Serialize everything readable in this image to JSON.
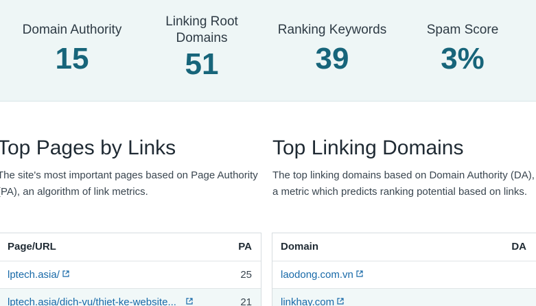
{
  "metrics": [
    {
      "label": "Domain Authority",
      "value": "15"
    },
    {
      "label_line1": "Linking Root",
      "label_line2": "Domains",
      "value": "51"
    },
    {
      "label": "Ranking Keywords",
      "value": "39"
    },
    {
      "label": "Spam Score",
      "value": "3%"
    }
  ],
  "top_pages": {
    "title": "Top Pages by Links",
    "description": "The site's most important pages based on Page Authority (PA), an algorithm of link metrics.",
    "columns": [
      "Page/URL",
      "PA"
    ],
    "rows": [
      {
        "url": "lptech.asia/",
        "value": "25"
      },
      {
        "url": "lptech.asia/dich-vu/thiet-ke-website...",
        "value": "21"
      }
    ]
  },
  "top_domains": {
    "title": "Top Linking Domains",
    "description": "The top linking domains based on Domain Authority (DA), a metric which predicts ranking potential based on links.",
    "columns": [
      "Domain",
      "DA"
    ],
    "rows": [
      {
        "domain": "laodong.com.vn",
        "value": ""
      },
      {
        "domain": "linkhay.com",
        "value": ""
      }
    ]
  },
  "icons": {
    "external_link": "external-link-icon"
  },
  "colors": {
    "accent": "#17657a",
    "link": "#1769a8",
    "banner_bg": "#eef6f6"
  }
}
